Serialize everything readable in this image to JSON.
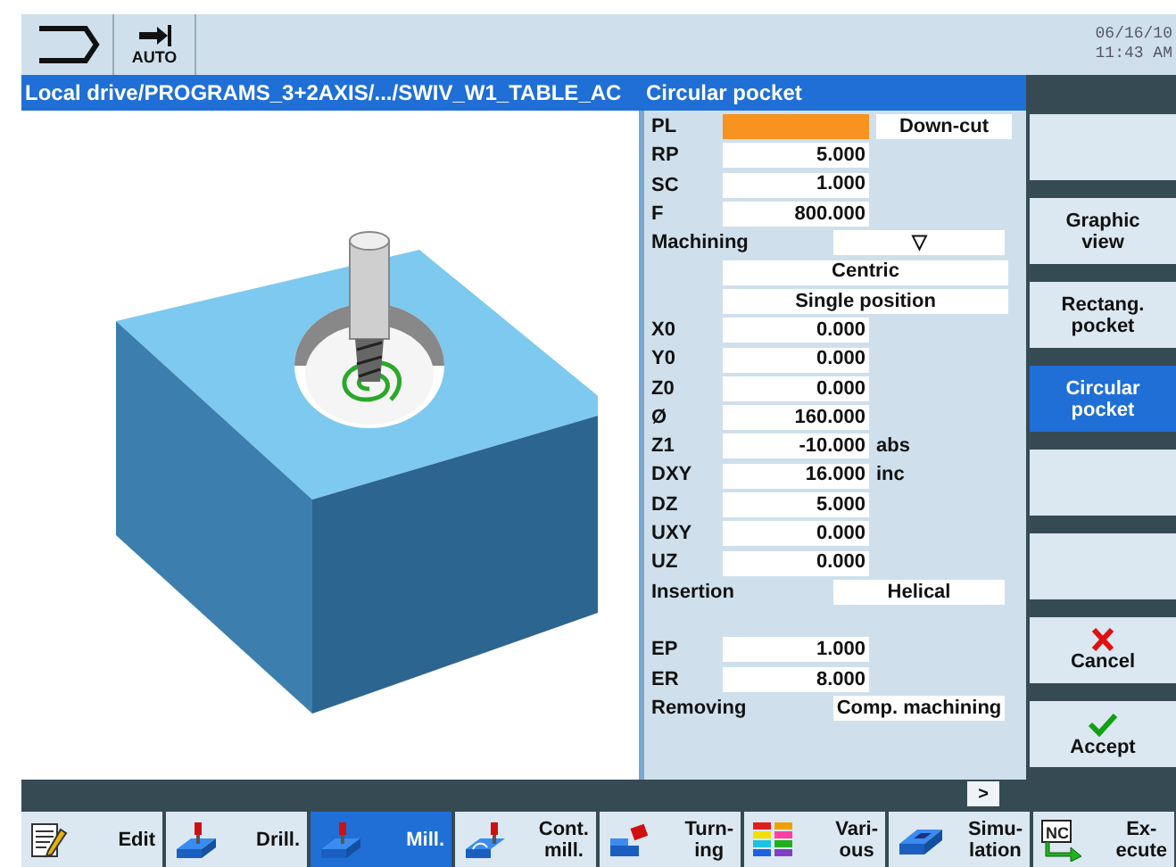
{
  "top_bar": {
    "mode_label": "AUTO",
    "date": "06/16/10",
    "time": "11:43 AM"
  },
  "title_bar": {
    "path": "Local drive/PROGRAMS_3+2AXIS/.../SWIV_W1_TABLE_AC",
    "form_title": "Circular pocket"
  },
  "params": [
    {
      "kind": "value",
      "label": "PL",
      "focused": true,
      "option": "Down-cut"
    },
    {
      "kind": "value",
      "label": "RP",
      "value": "5.000",
      "focused": false
    },
    {
      "kind": "value",
      "label": "SC",
      "value": "1.000",
      "focused": false
    },
    {
      "kind": "value",
      "label": "F",
      "value": "800.000",
      "focused": false
    },
    {
      "kind": "choice",
      "label": "Machining",
      "option": "▽"
    },
    {
      "kind": "option",
      "option": "Centric"
    },
    {
      "kind": "option",
      "option": "Single position"
    },
    {
      "kind": "value",
      "label": "X0",
      "value": "0.000",
      "focused": false
    },
    {
      "kind": "value",
      "label": "Y0",
      "value": "0.000",
      "focused": false
    },
    {
      "kind": "value",
      "label": "Z0",
      "value": "0.000",
      "focused": false
    },
    {
      "kind": "value",
      "label": "Ø",
      "value": "160.000",
      "focused": false
    },
    {
      "kind": "value",
      "label": "Z1",
      "value": "-10.000",
      "unit": "abs",
      "focused": false
    },
    {
      "kind": "value",
      "label": "DXY",
      "value": "16.000",
      "unit": "inc",
      "focused": false
    },
    {
      "kind": "value",
      "label": "DZ",
      "value": "5.000",
      "focused": false
    },
    {
      "kind": "value",
      "label": "UXY",
      "value": "0.000",
      "focused": false
    },
    {
      "kind": "value",
      "label": "UZ",
      "value": "0.000",
      "focused": false
    },
    {
      "kind": "choice",
      "label": "Insertion",
      "option": "Helical"
    },
    {
      "kind": "blank"
    },
    {
      "kind": "value",
      "label": "EP",
      "value": "1.000",
      "focused": false
    },
    {
      "kind": "value",
      "label": "ER",
      "value": "8.000",
      "focused": false
    },
    {
      "kind": "choice",
      "label": "Removing",
      "option": "Comp. machining"
    }
  ],
  "more_button": ">",
  "vertical_softkeys": [
    {
      "selected": false
    },
    {
      "label": "Graphic\nview",
      "selected": false
    },
    {
      "label": "Rectang.\npocket",
      "selected": false
    },
    {
      "label": "Circular\npocket",
      "selected": true
    },
    {
      "selected": false
    },
    {
      "selected": false
    },
    {
      "label": "Cancel",
      "kind": "cancel",
      "selected": false
    },
    {
      "label": "Accept",
      "kind": "accept",
      "selected": false
    }
  ],
  "horizontal_softkeys": [
    {
      "label": "Edit",
      "kind": "edit",
      "selected": false
    },
    {
      "label": "Drill.",
      "kind": "drill",
      "selected": false
    },
    {
      "label": "Mill.",
      "kind": "mill",
      "selected": true
    },
    {
      "label": "Cont.\nmill.",
      "kind": "contour",
      "selected": false
    },
    {
      "label": "Turn-\ning",
      "kind": "turn",
      "selected": false
    },
    {
      "label": "Vari-\nous",
      "kind": "various",
      "selected": false
    },
    {
      "label": "Simu-\nlation",
      "kind": "simulation",
      "selected": false
    },
    {
      "label": "Ex-\necute",
      "kind": "execute",
      "icon_text": "NC",
      "selected": false
    }
  ]
}
